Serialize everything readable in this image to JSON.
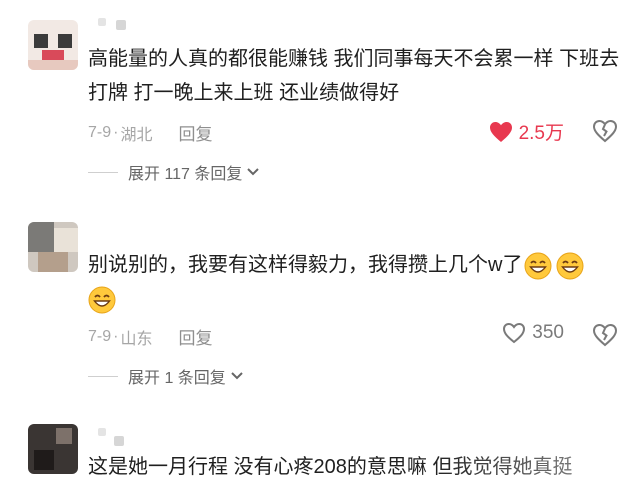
{
  "comments": [
    {
      "text": "高能量的人真的都很能赚钱 我们同事每天不会累一样 下班去打牌 打一晚上来上班 还业绩做得好",
      "date": "7-9",
      "dot": "·",
      "location": "湖北",
      "reply_label": "回复",
      "likes": "2.5万",
      "liked": true,
      "expand_label": "展开 117 条回复"
    },
    {
      "text": "别说别的，我要有这样得毅力，我得攒上几个w了",
      "emoji_icons": [
        "grinning-face-icon",
        "grinning-face-icon",
        "grinning-face-icon"
      ],
      "date": "7-9",
      "dot": "·",
      "location": "山东",
      "reply_label": "回复",
      "likes": "350",
      "liked": false,
      "expand_label": "展开 1 条回复"
    },
    {
      "text": "这是她一月行程 没有心疼208的意思嘛 但我觉得她真挺"
    }
  ],
  "colors": {
    "like_active": "#e8384f",
    "meta": "#a6a6a6"
  }
}
